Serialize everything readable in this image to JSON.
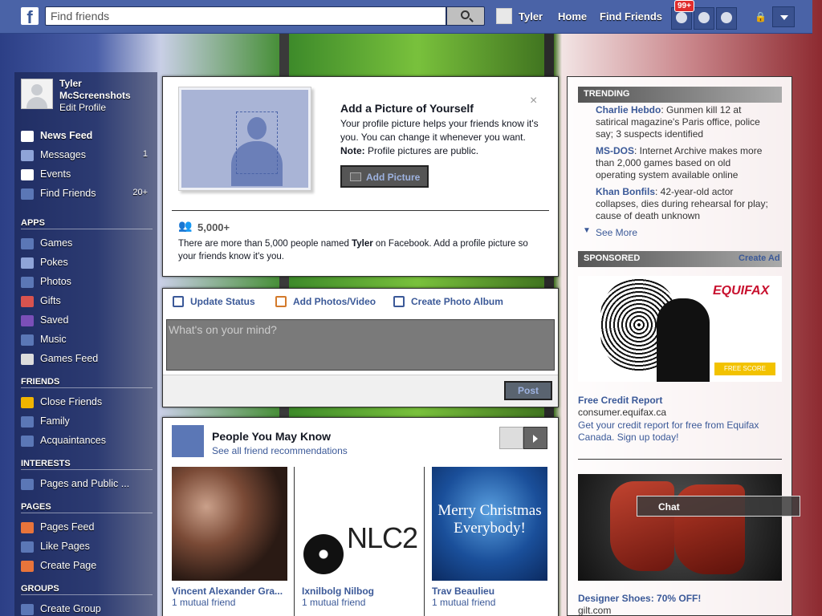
{
  "topbar": {
    "logo": "f",
    "search_placeholder": "Find friends",
    "user_name": "Tyler",
    "home": "Home",
    "find_friends": "Find Friends",
    "notification_count": "99+",
    "privacy_icon": "lock-icon",
    "settings_icon": "chevron-down-icon"
  },
  "profile": {
    "name": "Tyler McScreenshots",
    "edit": "Edit Profile"
  },
  "nav": {
    "favorites": [
      {
        "label": "News Feed",
        "count": "",
        "icon": "news-feed-icon",
        "color": "#ffffff"
      },
      {
        "label": "Messages",
        "count": "1",
        "icon": "messages-icon",
        "color": "#8fa4d8"
      },
      {
        "label": "Events",
        "count": "",
        "icon": "events-icon",
        "color": "#ffffff"
      },
      {
        "label": "Find Friends",
        "count": "20+",
        "icon": "find-friends-icon",
        "color": "#5b77b6"
      }
    ],
    "apps_header": "APPS",
    "apps": [
      {
        "label": "Games",
        "icon": "games-icon",
        "color": "#5b77b6"
      },
      {
        "label": "Pokes",
        "icon": "pokes-icon",
        "color": "#8fa4d8"
      },
      {
        "label": "Photos",
        "icon": "photos-icon",
        "color": "#5b77b6"
      },
      {
        "label": "Gifts",
        "icon": "gifts-icon",
        "color": "#d9534f"
      },
      {
        "label": "Saved",
        "icon": "saved-icon",
        "color": "#7b4fb8"
      },
      {
        "label": "Music",
        "icon": "music-icon",
        "color": "#5b77b6"
      },
      {
        "label": "Games Feed",
        "icon": "games-feed-icon",
        "color": "#dddddd"
      }
    ],
    "friends_header": "FRIENDS",
    "friends": [
      {
        "label": "Close Friends",
        "icon": "close-friends-icon",
        "color": "#f0b400"
      },
      {
        "label": "Family",
        "icon": "family-icon",
        "color": "#5b77b6"
      },
      {
        "label": "Acquaintances",
        "icon": "acquaintances-icon",
        "color": "#5b77b6"
      }
    ],
    "interests_header": "INTERESTS",
    "interests": [
      {
        "label": "Pages and Public ...",
        "icon": "rss-icon",
        "color": "#5b77b6"
      }
    ],
    "pages_header": "PAGES",
    "pages": [
      {
        "label": "Pages Feed",
        "icon": "pages-feed-icon",
        "color": "#e8743b"
      },
      {
        "label": "Like Pages",
        "icon": "like-icon",
        "color": "#5b77b6"
      },
      {
        "label": "Create Page",
        "icon": "create-page-icon",
        "color": "#e8743b"
      }
    ],
    "groups_header": "GROUPS",
    "groups": [
      {
        "label": "Create Group",
        "icon": "create-group-icon",
        "color": "#5b77b6"
      }
    ]
  },
  "profile_card": {
    "close": "×",
    "title": "Add a Picture of Yourself",
    "desc_main": "Your profile picture helps your friends know it's you. You can change it whenever you want. ",
    "desc_note_label": "Note:",
    "desc_note": " Profile pictures are public.",
    "button": "Add Picture",
    "count": "5,000+",
    "note_pre": "There are more than 5,000 people named ",
    "note_name": "Tyler",
    "note_post": " on Facebook. Add a profile picture so your friends know it's you."
  },
  "composer": {
    "tabs": [
      "Update Status",
      "Add Photos/Video",
      "Create Photo Album"
    ],
    "placeholder": "What's on your mind?",
    "post": "Post"
  },
  "pymk": {
    "title": "People You May Know",
    "subtitle": "See all friend recommendations",
    "people": [
      {
        "name": "Vincent Alexander Gra...",
        "mutual": "1 mutual friend"
      },
      {
        "name": "Ixnilbolg Nilbog",
        "mutual": "1 mutual friend",
        "logo": "NLC2"
      },
      {
        "name": "Trav Beaulieu",
        "mutual": "1 mutual friend",
        "greeting": "Merry Christmas Everybody!"
      }
    ]
  },
  "trending": {
    "header": "TRENDING",
    "items": [
      {
        "topic": "Charlie Hebdo",
        "text": ": Gunmen kill 12 at satirical magazine's Paris office, police say; 3 suspects identified"
      },
      {
        "topic": "MS-DOS",
        "text": ": Internet Archive makes more than 2,000 games based on old operating system available online"
      },
      {
        "topic": "Khan Bonfils",
        "text": ": 42-year-old actor collapses, dies during rehearsal for play; cause of death unknown"
      }
    ],
    "see_more": "See More"
  },
  "sponsored": {
    "header": "SPONSORED",
    "create_ad": "Create Ad",
    "ad1": {
      "brand": "EQUIFAX",
      "cta": "FREE SCORE",
      "title": "Free Credit Report",
      "url": "consumer.equifax.ca",
      "text": "Get your credit report for free from Equifax Canada. Sign up today!"
    },
    "ad2": {
      "title": "Designer Shoes: 70% OFF!",
      "url": "gilt.com"
    }
  },
  "chat": {
    "label": "Chat"
  }
}
